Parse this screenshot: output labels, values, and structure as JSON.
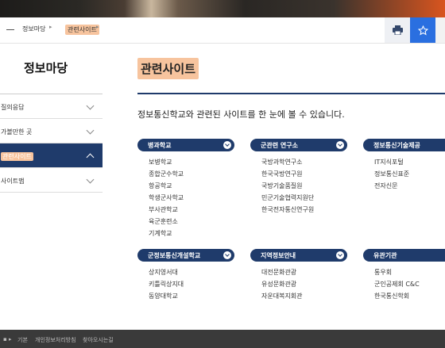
{
  "breadcrumb": {
    "items": [
      "정보마당",
      "관련사이트"
    ]
  },
  "toolbar": {
    "print_icon": "print-icon",
    "favorite_icon": "star-icon",
    "share_icon": "share-icon",
    "colors": {
      "print_bg": "#eef0f4",
      "favorite_bg": "#2a6fe0"
    }
  },
  "sidebar": {
    "title": "정보마당",
    "items": [
      {
        "label": "질의응답",
        "active": false
      },
      {
        "label": "가볼만한 곳",
        "active": false
      },
      {
        "label": "관련사이트",
        "active": true
      },
      {
        "label": "사이트맵",
        "active": false
      }
    ]
  },
  "main": {
    "title": "관련사이트",
    "intro": "정보통신학교와 관련된 사이트를 한 눈에 볼 수 있습니다.",
    "categories": [
      {
        "name": "병과학교",
        "links": [
          "보병학교",
          "종합군수학교",
          "항공학교",
          "학생군사학교",
          "부사관학교",
          "육군훈련소",
          "기계학교"
        ]
      },
      {
        "name": "군관련 연구소",
        "links": [
          "국방과학연구소",
          "한국국방연구원",
          "국방기술품질원",
          "민군기술협력지원단",
          "한국전자통신연구원"
        ]
      },
      {
        "name": "정보통신기술제공",
        "links": [
          "IT지식포털",
          "정보통신표준",
          "전자신문"
        ]
      },
      {
        "name": "군정보통신개설학교",
        "links": [
          "상지영서대",
          "키틀릭상지대",
          "동양대학교"
        ]
      },
      {
        "name": "지역정보안내",
        "links": [
          "대전문화관광",
          "유성문화관광",
          "자운대복지회관"
        ]
      },
      {
        "name": "유관기관",
        "links": [
          "통우회",
          "군인공제회 C&C",
          "한국통신학회"
        ]
      }
    ]
  },
  "footer": {
    "items": [
      "기본",
      "개인정보처리방침",
      "찾아오시는길"
    ]
  },
  "colors": {
    "navy": "#1f3b6b",
    "highlight": "#f7c49e",
    "accent_orange": "#d9551f"
  }
}
